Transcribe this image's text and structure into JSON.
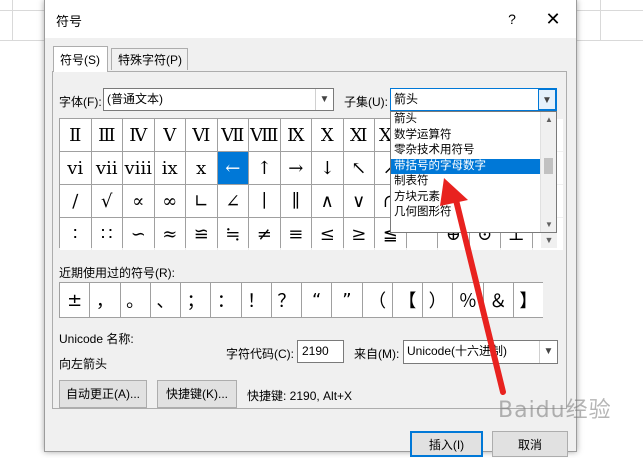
{
  "dialog": {
    "title": "符号",
    "help": "?",
    "close": "✕"
  },
  "tabs": [
    {
      "label": "符号(S)",
      "active": true
    },
    {
      "label": "特殊字符(P)",
      "active": false
    }
  ],
  "font": {
    "label": "字体(F):",
    "value": "(普通文本)"
  },
  "subset": {
    "label": "子集(U):",
    "value": "箭头"
  },
  "subset_options": [
    {
      "label": "箭头",
      "selected": false
    },
    {
      "label": "数学运算符",
      "selected": false
    },
    {
      "label": "零杂技术用符号",
      "selected": false
    },
    {
      "label": "带括号的字母数字",
      "selected": true
    },
    {
      "label": "制表符",
      "selected": false
    },
    {
      "label": "方块元素",
      "selected": false
    },
    {
      "label": "几何图形符",
      "selected": false
    }
  ],
  "symbol_grid": [
    [
      "Ⅱ",
      "Ⅲ",
      "Ⅳ",
      "Ⅴ",
      "Ⅵ",
      "Ⅶ",
      "Ⅷ",
      "Ⅸ",
      "Ⅹ",
      "Ⅺ",
      "Ⅻ",
      "",
      "",
      "",
      "",
      ""
    ],
    [
      "ⅵ",
      "ⅶ",
      "ⅷ",
      "ⅸ",
      "ⅹ",
      "←",
      "↑",
      "→",
      "↓",
      "↖",
      "↗",
      "",
      "",
      "",
      "",
      ""
    ],
    [
      "∕",
      "√",
      "∝",
      "∞",
      "∟",
      "∠",
      "∣",
      "∥",
      "∧",
      "∨",
      "∩",
      "",
      "",
      "",
      "",
      ""
    ],
    [
      "∶",
      "∷",
      "∽",
      "≈",
      "≌",
      "≒",
      "≠",
      "≡",
      "≤",
      "≥",
      "≦",
      "",
      "⊕",
      "⊙",
      "⊥",
      ""
    ]
  ],
  "selected_symbol_index": [
    1,
    5
  ],
  "recent": {
    "label": "近期使用过的符号(R):",
    "symbols": [
      "±",
      "，",
      "。",
      "、",
      "；",
      "：",
      "！",
      "？",
      "“",
      "”",
      "（",
      "【",
      "）",
      "％",
      "＆",
      "】"
    ]
  },
  "unicode_name": {
    "label": "Unicode 名称:",
    "value": "向左箭头"
  },
  "char_code": {
    "label": "字符代码(C):",
    "value": "2190"
  },
  "from": {
    "label": "来自(M):",
    "value": "Unicode(十六进制)"
  },
  "buttons": {
    "autocorrect": "自动更正(A)...",
    "shortcut_key": "快捷键(K)...",
    "shortcut_info": "快捷键: 2190, Alt+X",
    "insert": "插入(I)",
    "cancel": "取消"
  },
  "watermark": "Baidu经验",
  "colors": {
    "selection": "#0078d7",
    "annotation_arrow": "#e8221f"
  }
}
